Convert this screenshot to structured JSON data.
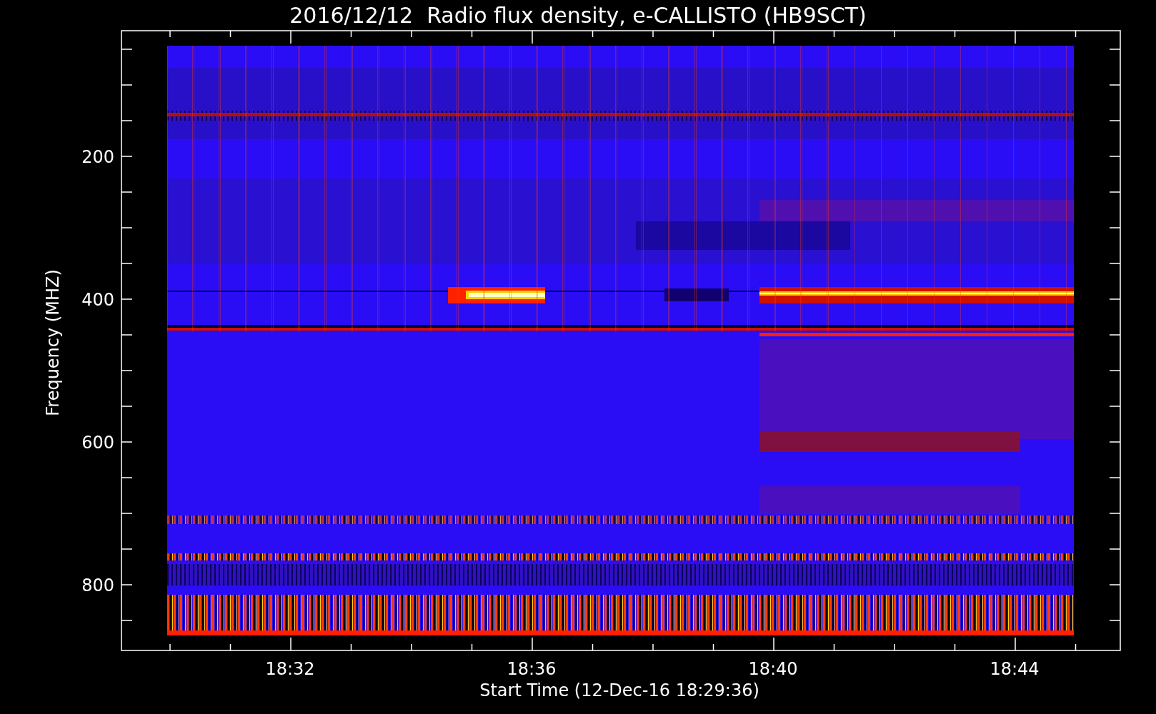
{
  "title": "2016/12/12  Radio flux density, e-CALLISTO (HB9SCT)",
  "plot": {
    "ylabel": "Frequency (MHZ)",
    "xlabel": "Start Time (12-Dec-16 18:29:36)",
    "yticks": [
      "200",
      "400",
      "600",
      "800"
    ],
    "xticks": [
      "18:32",
      "18:36",
      "18:40",
      "18:44"
    ]
  }
}
